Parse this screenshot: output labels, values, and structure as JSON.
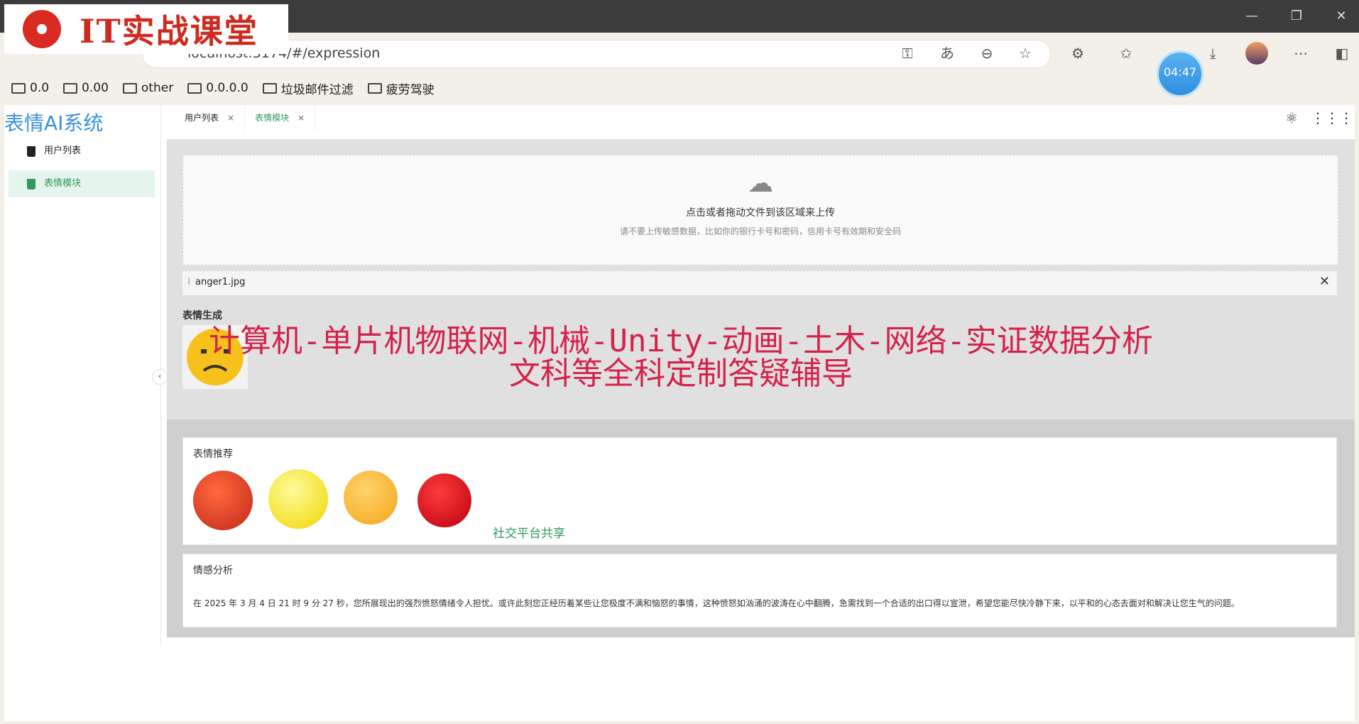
{
  "logo": {
    "text": "IT实战课堂"
  },
  "browser": {
    "address": "localhost:5174/#/expression",
    "clock": "04:47",
    "bookmarks": [
      "0.0",
      "0.00",
      "other",
      "0.0.0.0",
      "垃圾邮件过滤",
      "疲劳驾驶"
    ]
  },
  "app": {
    "system_title": "表情AI系统",
    "sidebar": {
      "items": [
        {
          "label": "用户列表",
          "active": false
        },
        {
          "label": "表情模块",
          "active": true
        }
      ]
    },
    "tabs": [
      {
        "label": "用户列表",
        "active": false
      },
      {
        "label": "表情模块",
        "active": true
      }
    ],
    "upload": {
      "main_text": "点击或者拖动文件到该区域来上传",
      "hint_text": "请不要上传敏感数据，比如你的银行卡号和密码，信用卡号有效期和安全码",
      "file_name": "anger1.jpg"
    },
    "generation": {
      "title": "表情生成"
    },
    "recommend": {
      "title": "表情推荐",
      "share_label": "社交平台共享"
    },
    "analysis": {
      "title": "情感分析",
      "text": "在 2025 年 3 月 4 日 21 时 9 分 27 秒，您所展现出的强烈愤怒情绪令人担忧。或许此刻您正经历着某些让您极度不满和恼怒的事情，这种愤怒如汹涌的波涛在心中翻腾，急需找到一个合适的出口得以宣泄，希望您能尽快冷静下来，以平和的心态去面对和解决让您生气的问题。"
    }
  },
  "overlay_banner": {
    "line1": "计算机-单片机物联网-机械-Unity-动画-土木-网络-实证数据分析",
    "line2": "文科等全科定制答疑辅导"
  },
  "colors": {
    "accent": "#2e9a5c",
    "brand": "#3a8fd9",
    "banner": "#d4234a"
  }
}
